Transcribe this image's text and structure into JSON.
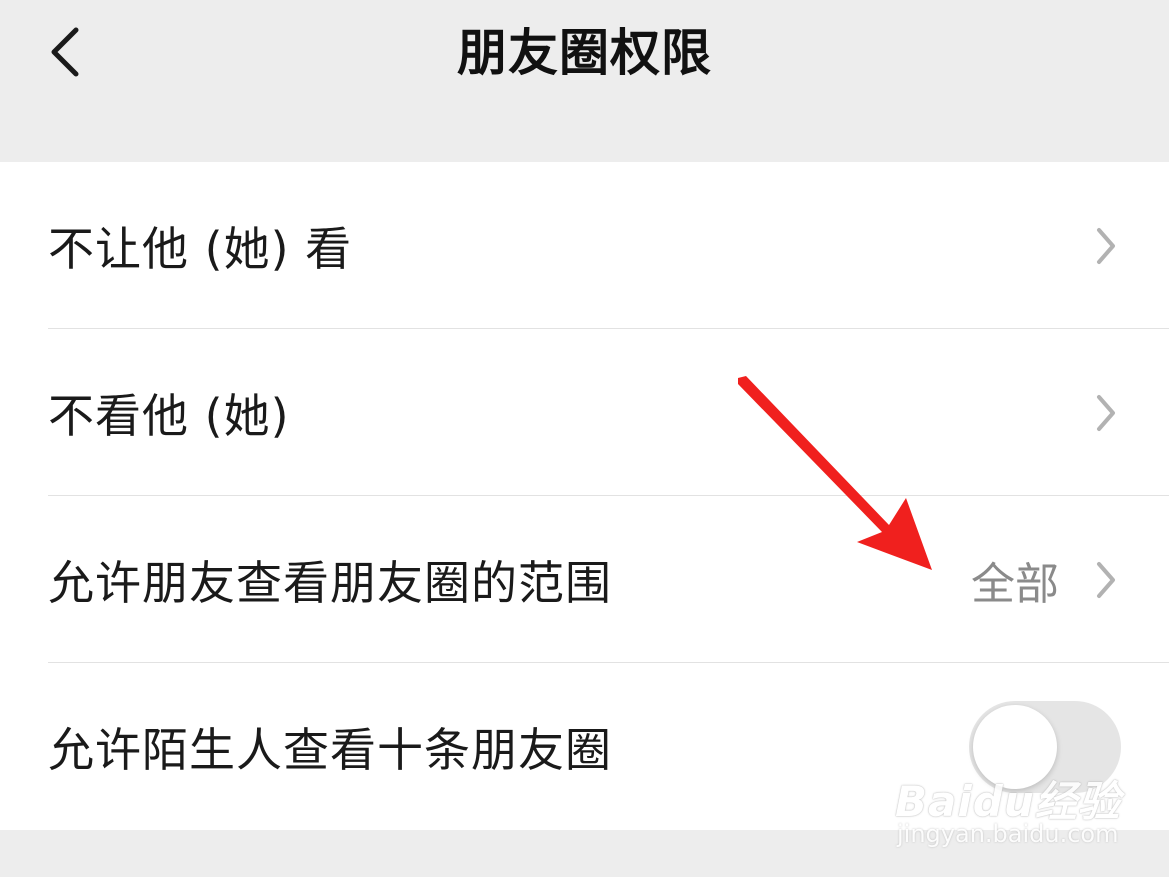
{
  "header": {
    "title": "朋友圈权限",
    "back_icon": "chevron-left-icon"
  },
  "settings": [
    {
      "label": "不让他 (她) 看",
      "value": "",
      "control": "chevron"
    },
    {
      "label": "不看他 (她)",
      "value": "",
      "control": "chevron"
    },
    {
      "label": "允许朋友查看朋友圈的范围",
      "value": "全部",
      "control": "chevron"
    },
    {
      "label": "允许陌生人查看十条朋友圈",
      "value": "",
      "control": "toggle",
      "toggle_on": false
    }
  ],
  "annotation": {
    "arrow_color": "#f0201e"
  },
  "watermark": {
    "brand": "Baidu经验",
    "url": "jingyan.baidu.com"
  },
  "colors": {
    "background": "#ededed",
    "card": "#ffffff",
    "text": "#1a1a1a",
    "secondary_text": "#8a8a8a",
    "divider": "#e2e2e2"
  }
}
